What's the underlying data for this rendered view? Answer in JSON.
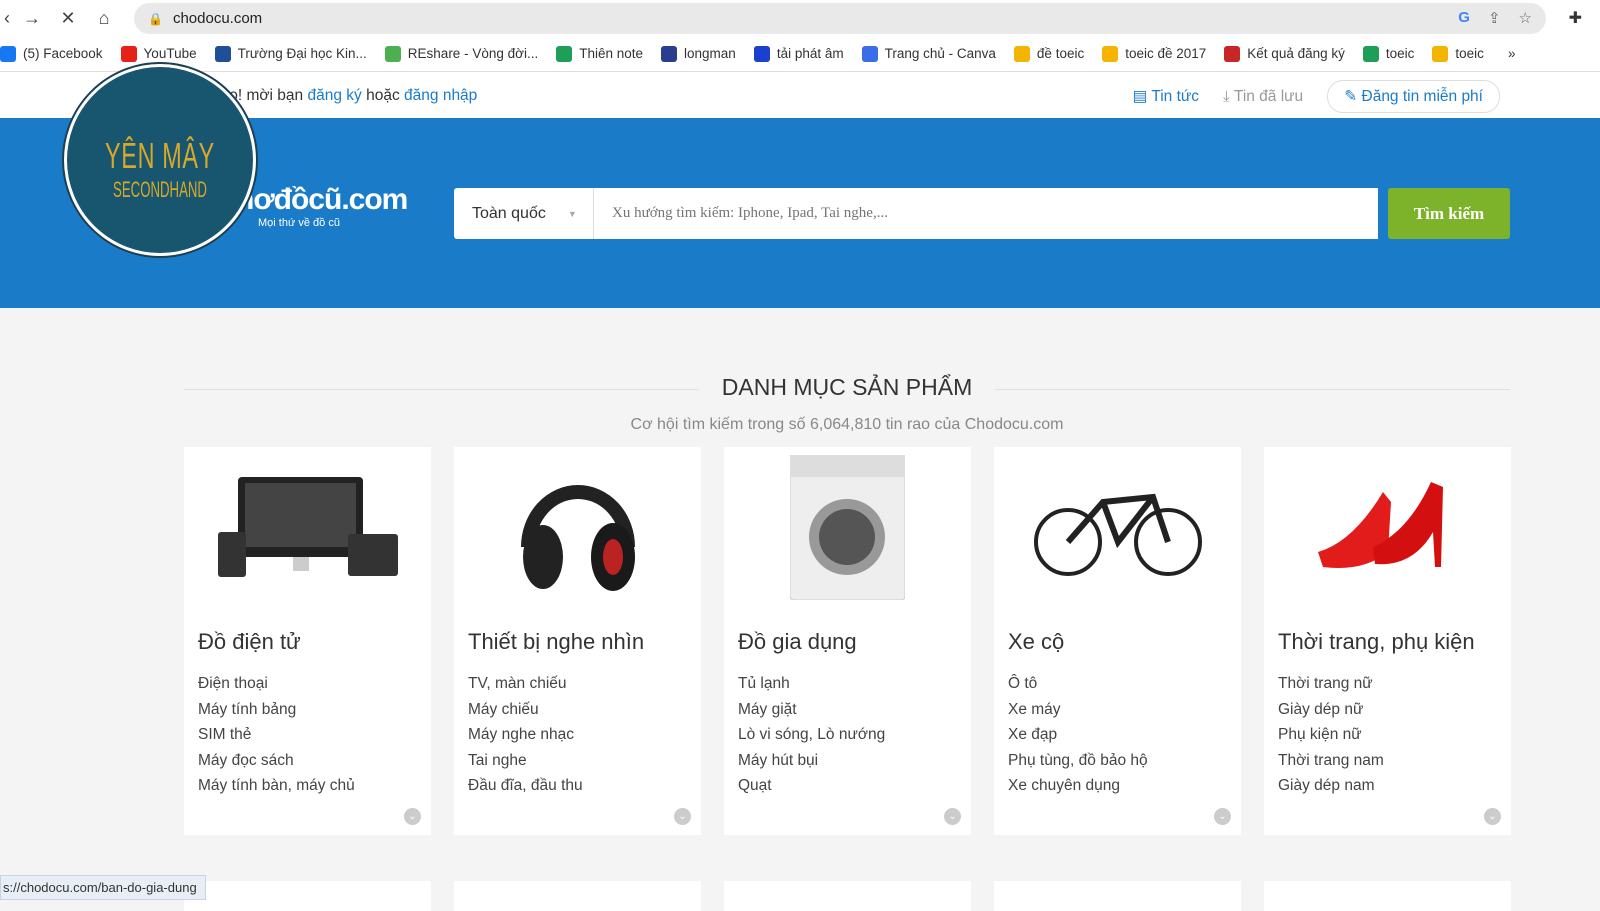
{
  "browser": {
    "url": "chodocu.com",
    "status_url": "s://chodocu.com/ban-do-gia-dung",
    "bookmarks": [
      {
        "label": "(5) Facebook",
        "color": "#1877f2"
      },
      {
        "label": "YouTube",
        "color": "#e62117"
      },
      {
        "label": "Trường Đại học Kin...",
        "color": "#1f4e9a"
      },
      {
        "label": "REshare - Vòng đời...",
        "color": "#4caf50"
      },
      {
        "label": "Thiên note",
        "color": "#1e9e57"
      },
      {
        "label": "longman",
        "color": "#2b3d8f"
      },
      {
        "label": "tải phát âm",
        "color": "#1a3fd1"
      },
      {
        "label": "Trang chủ - Canva",
        "color": "#3a6ee8"
      },
      {
        "label": "đề toeic",
        "color": "#f4b400"
      },
      {
        "label": "toeic đề 2017",
        "color": "#f4b400"
      },
      {
        "label": "Kết quả đăng ký",
        "color": "#c62828"
      },
      {
        "label": "toeic",
        "color": "#1e9e57"
      },
      {
        "label": "toeic",
        "color": "#f4b400"
      }
    ]
  },
  "topbar": {
    "greeting": "hào! mời bạn",
    "register": "đăng ký",
    "or": "hoặc",
    "login": "đăng nhập",
    "news": "Tin tức",
    "saved": "Tin đã lưu",
    "post": "Đăng tin miễn phí"
  },
  "badge": {
    "line1": "YÊN MÂY",
    "line2": "SECONDHAND"
  },
  "header": {
    "logo": "nơđồcũ.com",
    "tagline": "Mọi thứ về đồ cũ",
    "region": "Toàn quốc",
    "search_placeholder": "Xu hướng tìm kiếm: Iphone, Ipad, Tai nghe,...",
    "search_button": "Tìm kiếm"
  },
  "section": {
    "title": "DANH MỤC SẢN PHẨM",
    "subtitle": "Cơ hội tìm kiếm trong số 6,064,810 tin rao của Chodocu.com"
  },
  "categories": [
    {
      "title": "Đồ điện tử",
      "icon": "computer-devices",
      "items": [
        "Điện thoại",
        "Máy tính bảng",
        "SIM thẻ",
        "Máy đọc sách",
        "Máy tính bàn, máy chủ"
      ]
    },
    {
      "title": "Thiết bị nghe nhìn",
      "icon": "headphones",
      "items": [
        "TV, màn chiếu",
        "Máy chiếu",
        "Máy nghe nhạc",
        "Tai nghe",
        "Đầu đĩa, đầu thu"
      ]
    },
    {
      "title": "Đồ gia dụng",
      "icon": "washing-machine",
      "items": [
        "Tủ lạnh",
        "Máy giặt",
        "Lò vi sóng, Lò nướng",
        "Máy hút bụi",
        "Quạt"
      ]
    },
    {
      "title": "Xe cộ",
      "icon": "bicycle",
      "items": [
        "Ô tô",
        "Xe máy",
        "Xe đạp",
        "Phụ tùng, đồ bảo hộ",
        "Xe chuyên dụng"
      ]
    },
    {
      "title": "Thời trang, phụ kiện",
      "icon": "high-heels",
      "items": [
        "Thời trang nữ",
        "Giày dép nữ",
        "Phụ kiện nữ",
        "Thời trang nam",
        "Giày dép nam"
      ]
    }
  ]
}
